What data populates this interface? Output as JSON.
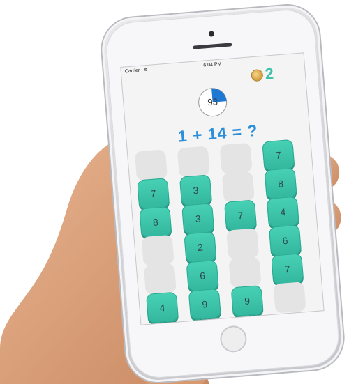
{
  "status_bar": {
    "carrier": "Carrier",
    "time": "6:04 PM"
  },
  "coins": {
    "count": "2"
  },
  "timer": {
    "value": "93",
    "fraction_elapsed": 0.25,
    "accent_color": "#1f78d1"
  },
  "question": {
    "text": "1 + 14 = ?"
  },
  "grid": {
    "cells": [
      "",
      "",
      "",
      "7",
      "7",
      "3",
      "",
      "8",
      "8",
      "3",
      "7",
      "4",
      "",
      "2",
      "",
      "6",
      "",
      "6",
      "",
      "7",
      "4",
      "9",
      "9",
      ""
    ]
  },
  "colors": {
    "tile": "#3fc4aa",
    "question": "#2c8fdc",
    "coin_number": "#3fc1a9"
  }
}
